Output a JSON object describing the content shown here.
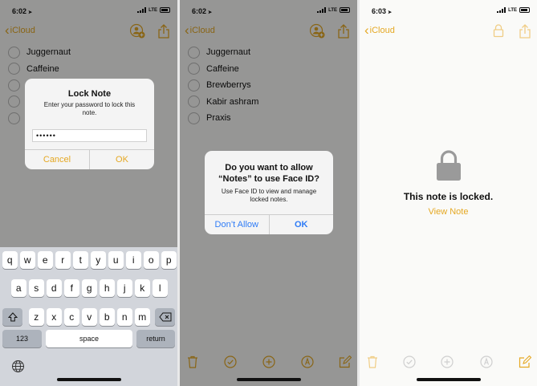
{
  "panels": [
    {
      "status_time": "6:02",
      "network": "LTE",
      "back_label": "iCloud",
      "checklist": [
        "Juggernaut",
        "Caffeine",
        "",
        "",
        ""
      ],
      "dialog": {
        "title": "Lock Note",
        "message": "Enter your password to lock this note.",
        "password_value": "••••••",
        "cancel_label": "Cancel",
        "ok_label": "OK"
      },
      "keyboard": {
        "row1": [
          "q",
          "w",
          "e",
          "r",
          "t",
          "y",
          "u",
          "i",
          "o",
          "p"
        ],
        "row2": [
          "a",
          "s",
          "d",
          "f",
          "g",
          "h",
          "j",
          "k",
          "l"
        ],
        "row3": [
          "z",
          "x",
          "c",
          "v",
          "b",
          "n",
          "m"
        ],
        "numbers_label": "123",
        "space_label": "space",
        "return_label": "return"
      }
    },
    {
      "status_time": "6:02",
      "network": "LTE",
      "back_label": "iCloud",
      "checklist": [
        "Juggernaut",
        "Caffeine",
        "Brewberrys",
        "Kabir ashram",
        "Praxis"
      ],
      "dialog": {
        "title": "Do you want to allow “Notes” to use Face ID?",
        "message": "Use Face ID to view and manage locked notes.",
        "dont_allow_label": "Don’t Allow",
        "ok_label": "OK"
      }
    },
    {
      "status_time": "6:03",
      "network": "LTE",
      "back_label": "iCloud",
      "locked_text": "This note is locked.",
      "view_note_label": "View Note"
    }
  ],
  "icons": [
    "share-icon",
    "add-people-icon",
    "lock-icon",
    "trash-icon",
    "checklist-icon",
    "add-icon",
    "markup-icon",
    "compose-icon",
    "globe-icon",
    "shift-icon",
    "delete-key-icon"
  ],
  "colors": {
    "accent": "#e5a823",
    "system_blue": "#2f7cf6",
    "dim_overlay": "rgba(0,0,0,0.40)"
  }
}
